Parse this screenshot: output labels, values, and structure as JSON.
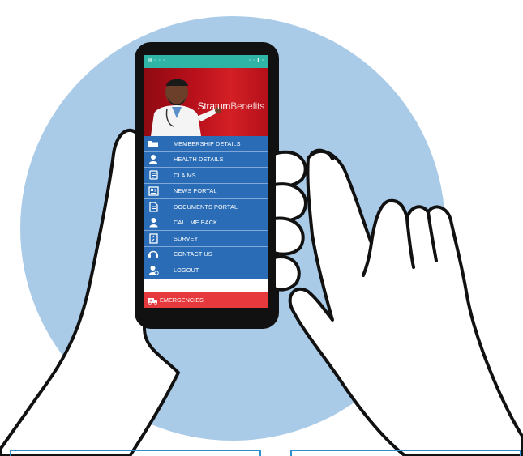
{
  "app": {
    "brand_part1": "Stratum",
    "brand_part2": "Benefits"
  },
  "statusbar": {
    "left": "▤ ◦ ◦ ◦",
    "right": "◦ ◦ ▮ ◦"
  },
  "menu": {
    "items": [
      {
        "label": "MEMBERSHIP DETAILS",
        "icon": "folder-icon"
      },
      {
        "label": "HEALTH DETAILS",
        "icon": "person-icon"
      },
      {
        "label": "CLAIMS",
        "icon": "claims-icon"
      },
      {
        "label": "NEWS PORTAL",
        "icon": "newspaper-icon"
      },
      {
        "label": "DOCUMENTS PORTAL",
        "icon": "document-icon"
      },
      {
        "label": "CALL ME BACK",
        "icon": "call-me-back-icon"
      },
      {
        "label": "SURVEY",
        "icon": "survey-icon"
      },
      {
        "label": "CONTACT US",
        "icon": "headset-icon"
      },
      {
        "label": "LOGOUT",
        "icon": "logout-icon"
      }
    ]
  },
  "emergencies": {
    "label": "EMERGENCIES",
    "icon": "ambulance-icon"
  },
  "colors": {
    "background_circle": "#a9cbe8",
    "menu_blue": "#2a6db6",
    "status_teal": "#2fb5a6",
    "emergency_red": "#e5393d",
    "banner_red": "#c8141e"
  }
}
